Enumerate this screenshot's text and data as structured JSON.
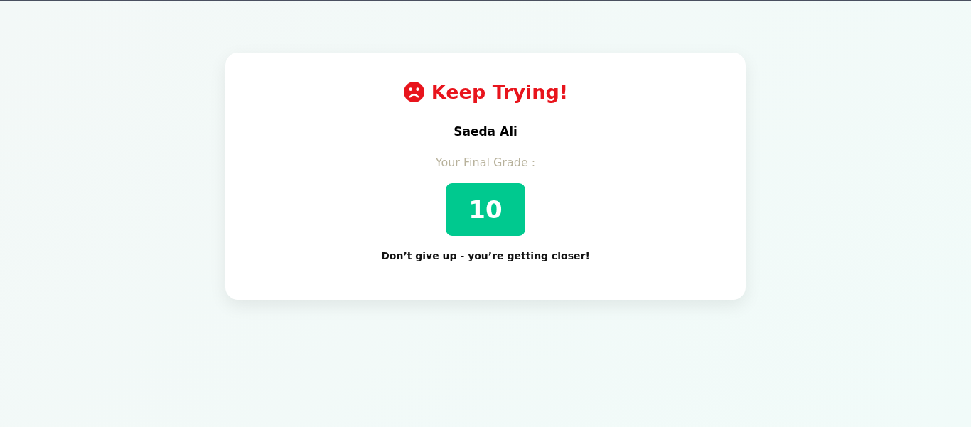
{
  "result": {
    "title": "Keep Trying!",
    "student_name": "Saeda Ali",
    "grade_label": "Your Final Grade :",
    "grade": "10",
    "message": "Don’t give up - you’re getting closer!"
  }
}
